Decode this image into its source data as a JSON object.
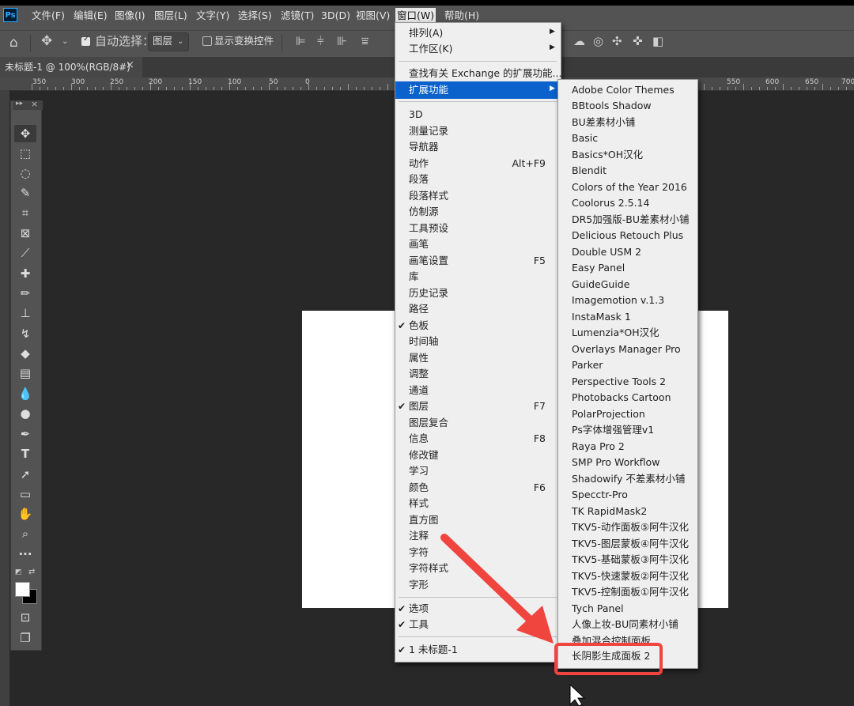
{
  "app": {
    "logo": "Ps"
  },
  "menubar": [
    "文件(F)",
    "编辑(E)",
    "图像(I)",
    "图层(L)",
    "文字(Y)",
    "选择(S)",
    "滤镜(T)",
    "3D(D)",
    "视图(V)",
    "窗口(W)",
    "帮助(H)"
  ],
  "options": {
    "auto_select_label": "自动选择：",
    "auto_select_value": "图层",
    "show_transform_label": "显示变换控件"
  },
  "doc_tab": {
    "title": "未标题-1 @ 100%(RGB/8#)",
    "close": "×"
  },
  "ruler_labels": [
    "350",
    "300",
    "250",
    "200",
    "150",
    "100",
    "50",
    "0",
    "550",
    "600",
    "650",
    "700"
  ],
  "toolbar_header": {
    "collapse": "▸▸",
    "close": "×"
  },
  "window_menu": {
    "top_items": [
      {
        "label": "排列(A)",
        "submenu": true
      },
      {
        "label": "工作区(K)",
        "submenu": true
      }
    ],
    "exchange_item": "查找有关 Exchange 的扩展功能...",
    "extensions_item": "扩展功能",
    "panels": [
      {
        "label": "3D",
        "check": false,
        "shortcut": ""
      },
      {
        "label": "测量记录",
        "check": false,
        "shortcut": ""
      },
      {
        "label": "导航器",
        "check": false,
        "shortcut": ""
      },
      {
        "label": "动作",
        "check": false,
        "shortcut": "Alt+F9"
      },
      {
        "label": "段落",
        "check": false,
        "shortcut": ""
      },
      {
        "label": "段落样式",
        "check": false,
        "shortcut": ""
      },
      {
        "label": "仿制源",
        "check": false,
        "shortcut": ""
      },
      {
        "label": "工具预设",
        "check": false,
        "shortcut": ""
      },
      {
        "label": "画笔",
        "check": false,
        "shortcut": ""
      },
      {
        "label": "画笔设置",
        "check": false,
        "shortcut": "F5"
      },
      {
        "label": "库",
        "check": false,
        "shortcut": ""
      },
      {
        "label": "历史记录",
        "check": false,
        "shortcut": ""
      },
      {
        "label": "路径",
        "check": false,
        "shortcut": ""
      },
      {
        "label": "色板",
        "check": true,
        "shortcut": ""
      },
      {
        "label": "时间轴",
        "check": false,
        "shortcut": ""
      },
      {
        "label": "属性",
        "check": false,
        "shortcut": ""
      },
      {
        "label": "调整",
        "check": false,
        "shortcut": ""
      },
      {
        "label": "通道",
        "check": false,
        "shortcut": ""
      },
      {
        "label": "图层",
        "check": true,
        "shortcut": "F7"
      },
      {
        "label": "图层复合",
        "check": false,
        "shortcut": ""
      },
      {
        "label": "信息",
        "check": false,
        "shortcut": "F8"
      },
      {
        "label": "修改键",
        "check": false,
        "shortcut": ""
      },
      {
        "label": "学习",
        "check": false,
        "shortcut": ""
      },
      {
        "label": "颜色",
        "check": false,
        "shortcut": "F6"
      },
      {
        "label": "样式",
        "check": false,
        "shortcut": ""
      },
      {
        "label": "直方图",
        "check": false,
        "shortcut": ""
      },
      {
        "label": "注释",
        "check": false,
        "shortcut": ""
      },
      {
        "label": "字符",
        "check": false,
        "shortcut": ""
      },
      {
        "label": "字符样式",
        "check": false,
        "shortcut": ""
      },
      {
        "label": "字形",
        "check": false,
        "shortcut": ""
      }
    ],
    "options_items": [
      {
        "label": "选项",
        "check": true
      },
      {
        "label": "工具",
        "check": true
      }
    ],
    "documents": [
      {
        "label": "1 未标题-1",
        "check": true
      }
    ]
  },
  "extensions_submenu": [
    "Adobe Color Themes",
    "BBtools Shadow",
    "BU差素材小铺",
    "Basic",
    "Basics*OH汉化",
    "Blendit",
    "Colors of the Year 2016",
    "Coolorus 2.5.14",
    "DR5加强版-BU差素材小铺",
    "Delicious Retouch Plus",
    "Double USM 2",
    "Easy Panel",
    "GuideGuide",
    "Imagemotion v.1.3",
    "InstaMask 1",
    "Lumenzia*OH汉化",
    "Overlays Manager Pro",
    "Parker",
    "Perspective Tools 2",
    "Photobacks Cartoon",
    "PolarProjection",
    "Ps字体增强管理v1",
    "Raya Pro 2",
    "SMP Pro Workflow",
    "Shadowify 不差素材小铺",
    "Specctr-Pro",
    "TK RapidMask2",
    "TKV5-动作面板⑤阿牛汉化",
    "TKV5-图层蒙板④阿牛汉化",
    "TKV5-基础蒙板③阿牛汉化",
    "TKV5-快速蒙板②阿牛汉化",
    "TKV5-控制面板①阿牛汉化",
    "Tych Panel",
    "人像上妆-BU同素材小铺",
    "叠加混合控制面板",
    "长阴影生成面板 2"
  ],
  "colors": {
    "highlight": "#0b62cc",
    "annotation": "#f0443f",
    "menu_bg": "#efefef"
  }
}
